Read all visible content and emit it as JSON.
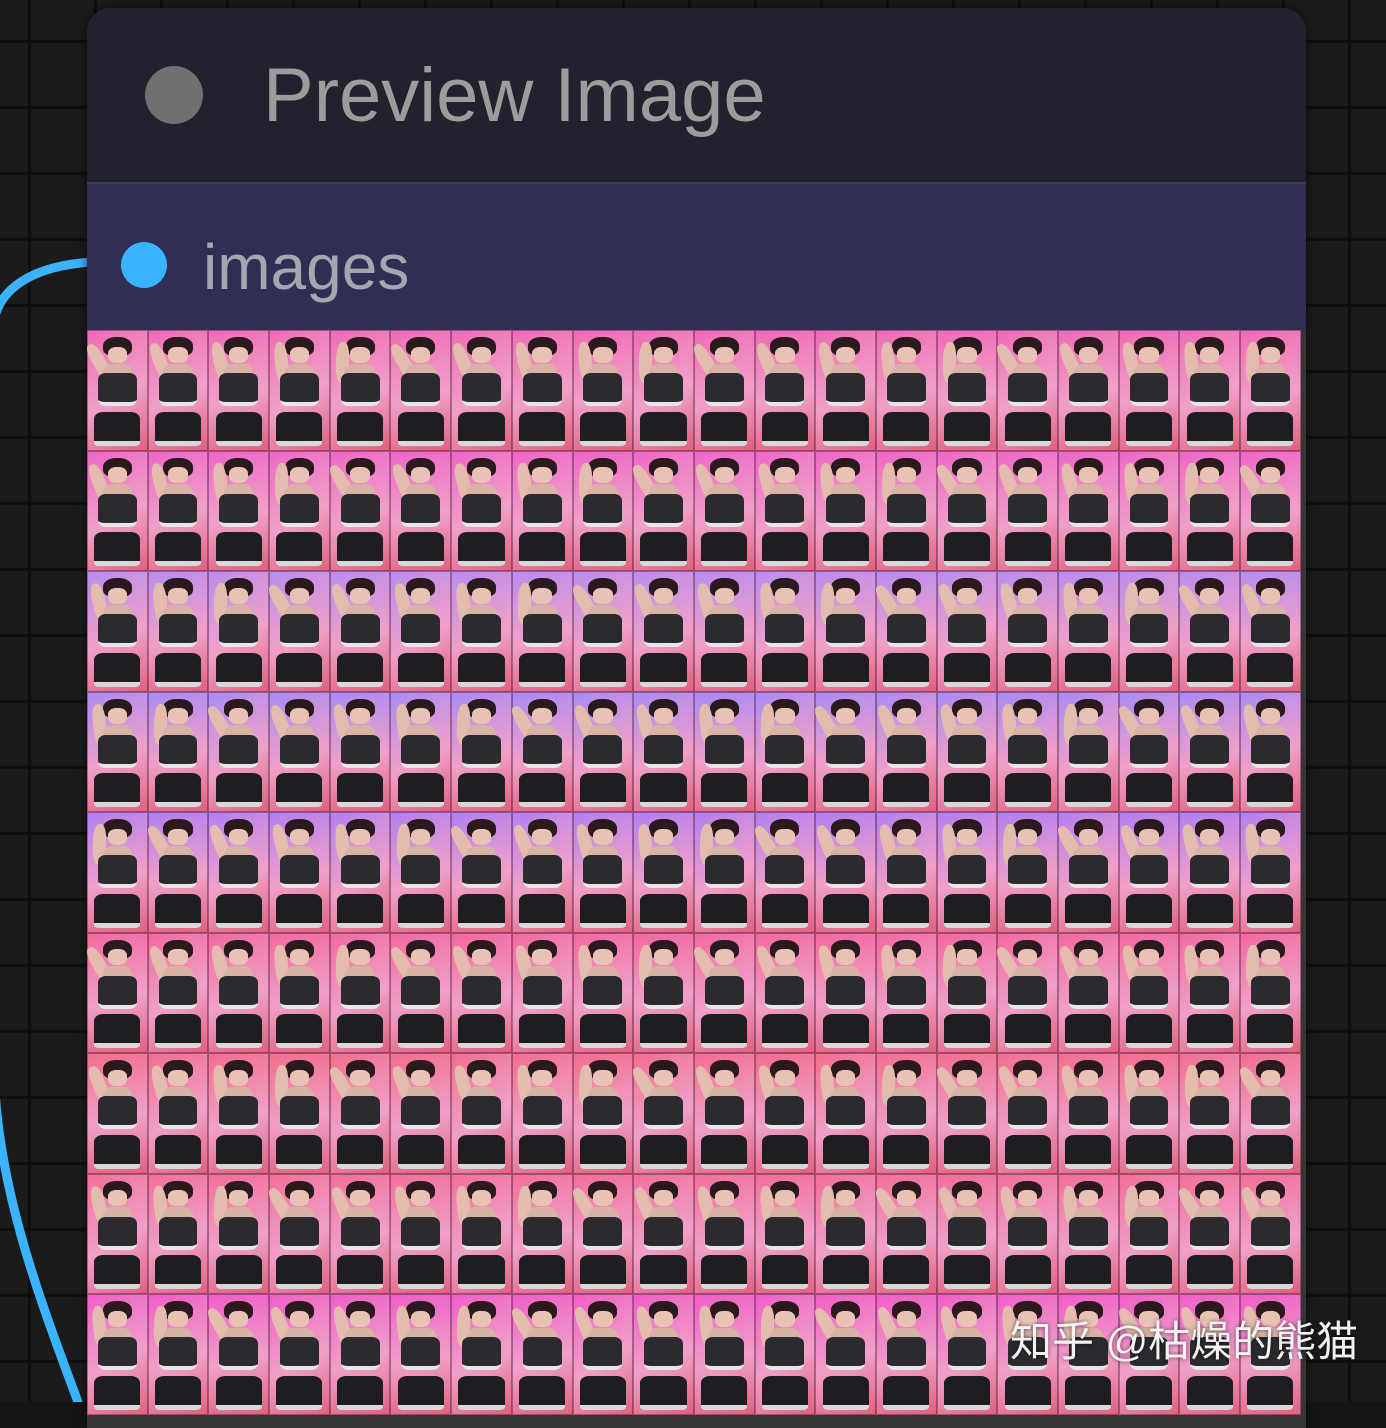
{
  "node": {
    "title": "Preview Image",
    "input_label": "images",
    "header_color": "#22222f",
    "slot_bg_color": "#2f2f55",
    "slot_dot_color": "#3ab4ff",
    "collapse_dot_color": "#707070"
  },
  "link": {
    "color": "#3ab4ff"
  },
  "preview": {
    "columns": 20,
    "rows": 9,
    "frame_tints": [
      "#f06ab6",
      "#ee66c8",
      "#b88cf0",
      "#a98af5",
      "#b27ef2",
      "#f2679c",
      "#f26c8c",
      "#f26d9a",
      "#f05cc8"
    ]
  },
  "watermark": {
    "text": "知乎 @枯燥的熊猫"
  }
}
